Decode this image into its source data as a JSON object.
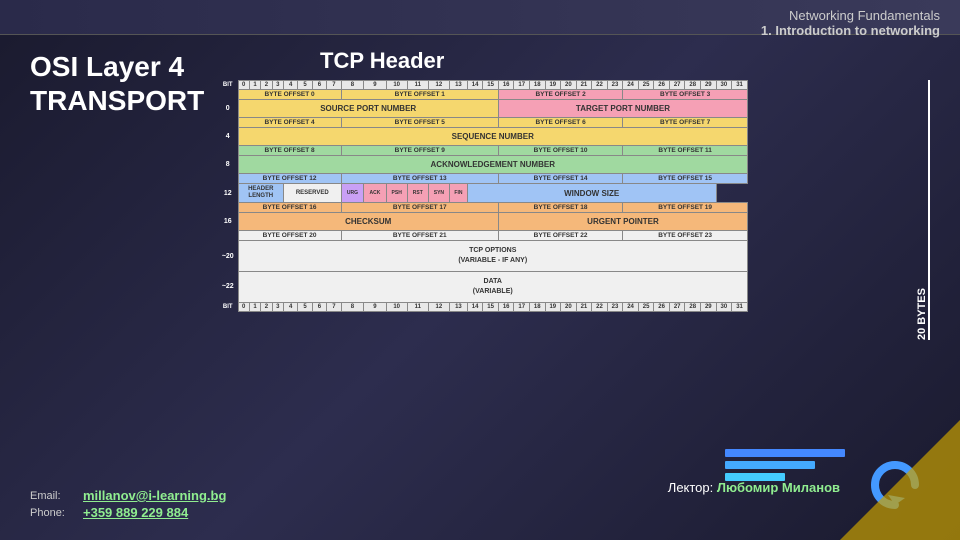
{
  "header": {
    "line1": "Networking Fundamentals",
    "line2": "1. Introduction to networking"
  },
  "left_title": {
    "line1": "OSI Layer 4",
    "line2": "TRANSPORT"
  },
  "tcp_title": "TCP Header",
  "bytes_label": "20 BYTES",
  "diagram": {
    "bit_numbers": [
      "0",
      "1",
      "2",
      "3",
      "4",
      "5",
      "6",
      "7",
      "8",
      "9",
      "10",
      "11",
      "12",
      "13",
      "14",
      "15",
      "16",
      "17",
      "18",
      "19",
      "20",
      "21",
      "22",
      "23",
      "24",
      "25",
      "26",
      "27",
      "28",
      "29",
      "30",
      "31"
    ],
    "rows": [
      {
        "row_label": "",
        "cells": [
          {
            "text": "BYTE OFFSET 0",
            "colspan": 8,
            "color": "c-yellow"
          },
          {
            "text": "BYTE OFFSET 1",
            "colspan": 8,
            "color": "c-yellow"
          },
          {
            "text": "BYTE OFFSET 2",
            "colspan": 8,
            "color": "c-pink"
          },
          {
            "text": "BYTE OFFSET 3",
            "colspan": 8,
            "color": "c-pink"
          }
        ]
      },
      {
        "row_label": "0",
        "cells": [
          {
            "text": "SOURCE PORT NUMBER",
            "colspan": 16,
            "color": "c-yellow"
          },
          {
            "text": "TARGET PORT NUMBER",
            "colspan": 16,
            "color": "c-pink"
          }
        ]
      },
      {
        "row_label": "",
        "cells": [
          {
            "text": "BYTE OFFSET 4",
            "colspan": 8,
            "color": "c-yellow"
          },
          {
            "text": "BYTE OFFSET 5",
            "colspan": 8,
            "color": "c-yellow"
          },
          {
            "text": "BYTE OFFSET 6",
            "colspan": 8,
            "color": "c-yellow"
          },
          {
            "text": "BYTE OFFSET 7",
            "colspan": 8,
            "color": "c-yellow"
          }
        ]
      },
      {
        "row_label": "4",
        "cells": [
          {
            "text": "SEQUENCE NUMBER",
            "colspan": 32,
            "color": "c-yellow"
          }
        ]
      },
      {
        "row_label": "",
        "cells": [
          {
            "text": "BYTE OFFSET 8",
            "colspan": 8,
            "color": "c-green"
          },
          {
            "text": "BYTE OFFSET 9",
            "colspan": 8,
            "color": "c-green"
          },
          {
            "text": "BYTE OFFSET 10",
            "colspan": 8,
            "color": "c-green"
          },
          {
            "text": "BYTE OFFSET 11",
            "colspan": 8,
            "color": "c-green"
          }
        ]
      },
      {
        "row_label": "8",
        "cells": [
          {
            "text": "ACKNOWLEDGEMENT NUMBER",
            "colspan": 32,
            "color": "c-green"
          }
        ]
      },
      {
        "row_label": "",
        "cells": [
          {
            "text": "BYTE OFFSET 12",
            "colspan": 8,
            "color": "c-blue"
          },
          {
            "text": "BYTE OFFSET 13",
            "colspan": 8,
            "color": "c-blue"
          },
          {
            "text": "BYTE OFFSET 14",
            "colspan": 8,
            "color": "c-blue"
          },
          {
            "text": "BYTE OFFSET 15",
            "colspan": 8,
            "color": "c-blue"
          }
        ]
      },
      {
        "row_label": "12",
        "cells_special": true
      },
      {
        "row_label": "",
        "cells": [
          {
            "text": "BYTE OFFSET 16",
            "colspan": 8,
            "color": "c-orange"
          },
          {
            "text": "BYTE OFFSET 17",
            "colspan": 8,
            "color": "c-orange"
          },
          {
            "text": "BYTE OFFSET 18",
            "colspan": 8,
            "color": "c-orange"
          },
          {
            "text": "BYTE OFFSET 19",
            "colspan": 8,
            "color": "c-orange"
          }
        ]
      },
      {
        "row_label": "16",
        "cells": [
          {
            "text": "CHECKSUM",
            "colspan": 16,
            "color": "c-orange"
          },
          {
            "text": "URGENT POINTER",
            "colspan": 16,
            "color": "c-orange"
          }
        ]
      },
      {
        "row_label": "",
        "cells": [
          {
            "text": "BYTE OFFSET 20",
            "colspan": 8,
            "color": "c-white"
          },
          {
            "text": "BYTE OFFSET 21",
            "colspan": 8,
            "color": "c-white"
          },
          {
            "text": "BYTE OFFSET 22",
            "colspan": 8,
            "color": "c-white"
          },
          {
            "text": "BYTE OFFSET 23",
            "colspan": 8,
            "color": "c-white"
          }
        ]
      },
      {
        "row_label": "~20",
        "cells": [
          {
            "text": "TCP OPTIONS\n(VARIABLE - IF ANY)",
            "colspan": 32,
            "color": "c-white"
          }
        ]
      },
      {
        "row_label": "~22",
        "cells": [
          {
            "text": "DATA\n(VARIABLE)",
            "colspan": 32,
            "color": "c-white"
          }
        ]
      }
    ]
  },
  "lecturer": {
    "prefix": "Лектор:",
    "name": "Любомир Миланов"
  },
  "contact": {
    "email_label": "Email:",
    "email_value": "millanov@i-learning.bg",
    "phone_label": "Phone:",
    "phone_value": "+359 889 229 884"
  },
  "progress_bars": [
    {
      "width": "100%",
      "color": "#4488ff"
    },
    {
      "width": "75%",
      "color": "#44aaff"
    },
    {
      "width": "50%",
      "color": "#44ccff"
    }
  ]
}
